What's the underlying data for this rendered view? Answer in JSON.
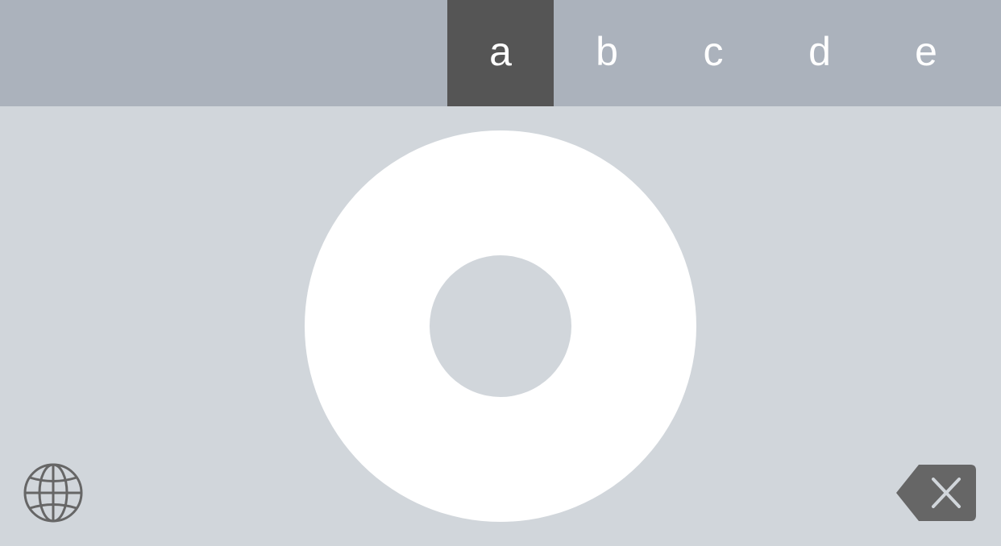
{
  "letter_bar": {
    "letters": [
      "a",
      "b",
      "c",
      "d",
      "e"
    ],
    "selected": "a"
  },
  "icons": {
    "globe": "globe-icon",
    "delete": "backspace-icon"
  },
  "colors": {
    "keyboard_background": "#d1d6db",
    "letter_bar_background": "#abb2bc",
    "selected_key_background": "#555555",
    "letter_text": "#ffffff",
    "wheel": "#ffffff",
    "icon_gray": "#666666"
  }
}
